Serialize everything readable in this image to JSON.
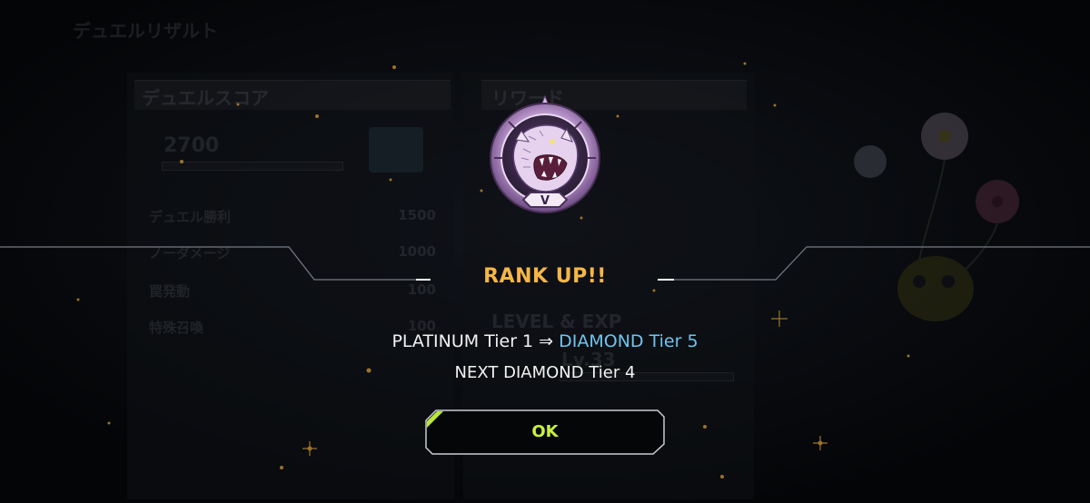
{
  "background": {
    "screen_title": "デュエルリザルト",
    "score_panel": {
      "header": "デュエルスコア",
      "total": "2700",
      "rows": [
        {
          "label": "デュエル勝利",
          "value": "1500"
        },
        {
          "label": "ノーダメージ",
          "value": "1000"
        },
        {
          "label": "罠発動",
          "value": "100"
        },
        {
          "label": "特殊召喚",
          "value": "100"
        }
      ]
    },
    "reward_panel": {
      "header": "リワード",
      "level_header": "LEVEL & EXP",
      "level_value": "Lv.33"
    }
  },
  "dialog": {
    "badge_icon": "rank-emblem-beast-icon",
    "badge_tier": "V",
    "title": "RANK UP!!",
    "from_rank": "PLATINUM Tier 1",
    "arrow": " ⇒ ",
    "to_rank": "DIAMOND Tier 5",
    "next_rank": "NEXT DIAMOND Tier 4",
    "ok_label": "OK"
  },
  "colors": {
    "title": "#f4b648",
    "new_rank": "#6fc4ef",
    "ok_text": "#c8f043",
    "ok_accent": "#b8e83a",
    "badge": "#c7a3d8"
  }
}
